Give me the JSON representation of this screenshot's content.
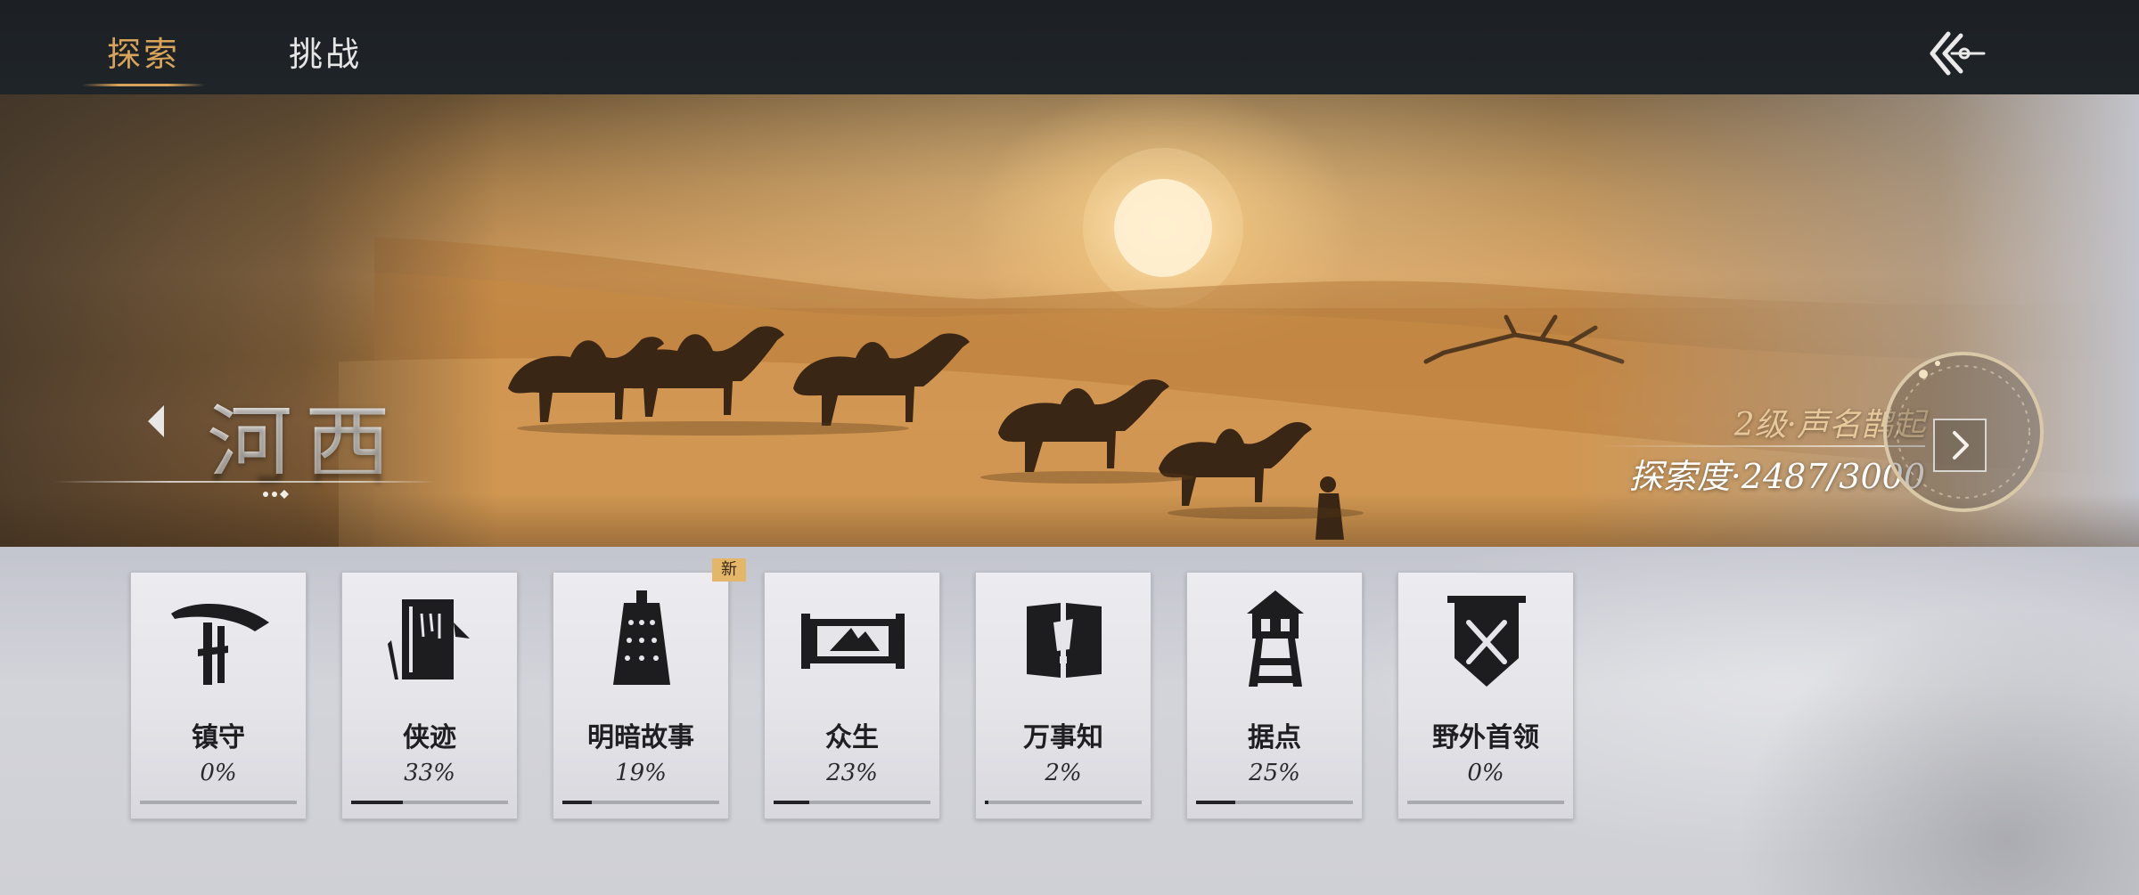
{
  "tabs": [
    {
      "label": "探索",
      "active": true
    },
    {
      "label": "挑战",
      "active": false
    }
  ],
  "region": {
    "name": "河西",
    "level_text": "2级·声名鹊起",
    "exploration_text": "探索度·2487/3000"
  },
  "cards": [
    {
      "title": "镇守",
      "percent_label": "0%",
      "progress": 0,
      "icon": "umbrella-hat-icon",
      "badge": ""
    },
    {
      "title": "侠迹",
      "percent_label": "33%",
      "progress": 0.33,
      "icon": "scroll-book-icon",
      "badge": ""
    },
    {
      "title": "明暗故事",
      "percent_label": "19%",
      "progress": 0.19,
      "icon": "bell-icon",
      "badge": "新"
    },
    {
      "title": "众生",
      "percent_label": "23%",
      "progress": 0.23,
      "icon": "painting-scroll-icon",
      "badge": ""
    },
    {
      "title": "万事知",
      "percent_label": "2%",
      "progress": 0.02,
      "icon": "notice-board-icon",
      "badge": ""
    },
    {
      "title": "据点",
      "percent_label": "25%",
      "progress": 0.25,
      "icon": "watchtower-icon",
      "badge": ""
    },
    {
      "title": "野外首领",
      "percent_label": "0%",
      "progress": 0,
      "icon": "crossed-swords-banner-icon",
      "badge": ""
    }
  ],
  "colors": {
    "accent_gold": "#d8a45a",
    "topbar": "#1c2024",
    "badge": "#e4b768"
  }
}
